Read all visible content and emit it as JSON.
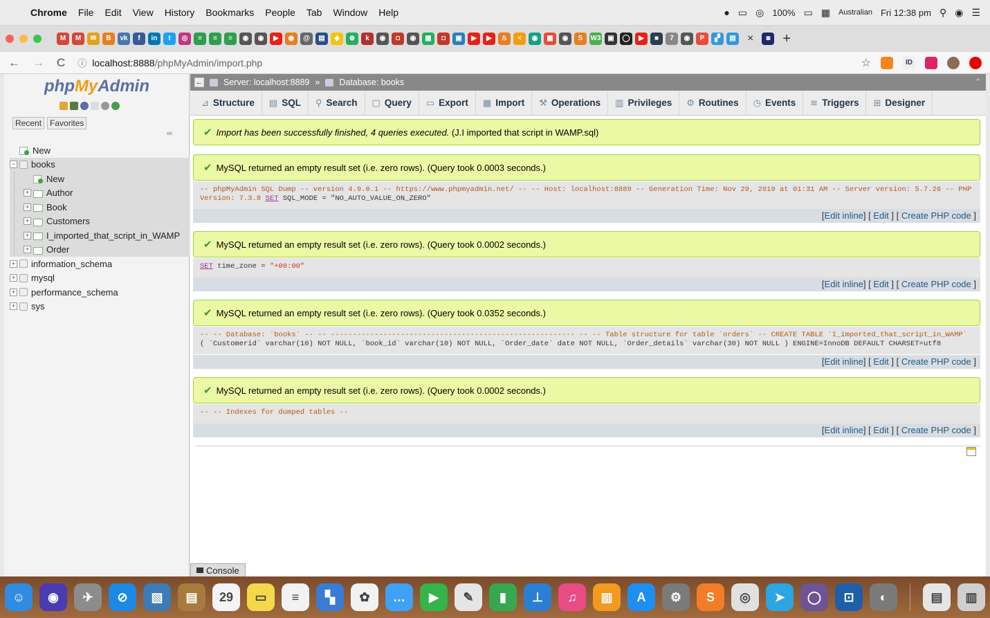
{
  "menubar": {
    "apple": "",
    "items": [
      "Chrome",
      "File",
      "Edit",
      "View",
      "History",
      "Bookmarks",
      "People",
      "Tab",
      "Window",
      "Help"
    ],
    "battery": "100%",
    "locale": "Australian",
    "clock": "Fri 12:38 pm"
  },
  "tabs": {
    "favicons": [
      {
        "label": "M",
        "color": "#d44638"
      },
      {
        "label": "M",
        "color": "#d44638"
      },
      {
        "label": "✉",
        "color": "#e4a11b"
      },
      {
        "label": "B",
        "color": "#e67e22"
      },
      {
        "label": "vk",
        "color": "#4a76a8"
      },
      {
        "label": "f",
        "color": "#3b5998"
      },
      {
        "label": "in",
        "color": "#0077b5"
      },
      {
        "label": "t",
        "color": "#1da1f2"
      },
      {
        "label": "◎",
        "color": "#c13584"
      },
      {
        "label": "≡",
        "color": "#2e9e4f"
      },
      {
        "label": "≡",
        "color": "#2e9e4f"
      },
      {
        "label": "≡",
        "color": "#2e9e4f"
      },
      {
        "label": "◉",
        "color": "#555555"
      },
      {
        "label": "◉",
        "color": "#555555"
      },
      {
        "label": "▶",
        "color": "#e62117"
      },
      {
        "label": "◉",
        "color": "#e67e22"
      },
      {
        "label": "@",
        "color": "#666666"
      },
      {
        "label": "▤",
        "color": "#2b4f81"
      },
      {
        "label": "◆",
        "color": "#f1c40f"
      },
      {
        "label": "⊕",
        "color": "#27ae60"
      },
      {
        "label": "k",
        "color": "#b03030"
      },
      {
        "label": "◉",
        "color": "#555555"
      },
      {
        "label": "◘",
        "color": "#c0392b"
      },
      {
        "label": "◉",
        "color": "#555555"
      },
      {
        "label": "▦",
        "color": "#27ae60"
      },
      {
        "label": "◘",
        "color": "#c0392b"
      },
      {
        "label": "▣",
        "color": "#2980b9"
      },
      {
        "label": "▶",
        "color": "#e62117"
      },
      {
        "label": "▶",
        "color": "#e62117"
      },
      {
        "label": "♨",
        "color": "#e67e22"
      },
      {
        "label": "<",
        "color": "#f39c12"
      },
      {
        "label": "◉",
        "color": "#16a085"
      },
      {
        "label": "▩",
        "color": "#e74c3c"
      },
      {
        "label": "◉",
        "color": "#555555"
      },
      {
        "label": "S",
        "color": "#e67e22"
      },
      {
        "label": "W3",
        "color": "#4caf50"
      },
      {
        "label": "▣",
        "color": "#333333"
      },
      {
        "label": "◯",
        "color": "#222222"
      },
      {
        "label": "▶",
        "color": "#e62117"
      },
      {
        "label": "■",
        "color": "#2c3e50"
      },
      {
        "label": "7",
        "color": "#888888"
      },
      {
        "label": "◉",
        "color": "#555555"
      },
      {
        "label": "P",
        "color": "#e74c3c"
      },
      {
        "label": "▞",
        "color": "#3498db"
      },
      {
        "label": "▤",
        "color": "#3498db"
      }
    ],
    "close": "×",
    "new": "+"
  },
  "address": {
    "host": "localhost:8888",
    "path": "/phpMyAdmin/import.php"
  },
  "logo": {
    "php": "php",
    "my": "My",
    "admin": "Admin"
  },
  "nav": {
    "recent": "Recent",
    "favorites": "Favorites",
    "link_icon": "∞",
    "tree": [
      {
        "label": "New",
        "level": 0,
        "kind": "new"
      },
      {
        "label": "books",
        "level": 0,
        "kind": "db",
        "expanded": true
      },
      {
        "label": "New",
        "level": 1,
        "kind": "new"
      },
      {
        "label": "Author",
        "level": 1,
        "kind": "table"
      },
      {
        "label": "Book",
        "level": 1,
        "kind": "table"
      },
      {
        "label": "Customers",
        "level": 1,
        "kind": "table"
      },
      {
        "label": "I_imported_that_script_in_WAMP",
        "level": 1,
        "kind": "table"
      },
      {
        "label": "Order",
        "level": 1,
        "kind": "table"
      },
      {
        "label": "information_schema",
        "level": 0,
        "kind": "db"
      },
      {
        "label": "mysql",
        "level": 0,
        "kind": "db"
      },
      {
        "label": "performance_schema",
        "level": 0,
        "kind": "db"
      },
      {
        "label": "sys",
        "level": 0,
        "kind": "db"
      }
    ]
  },
  "breadcrumb": {
    "server": "Server: localhost:8889",
    "sep": "»",
    "database": "Database: books"
  },
  "topmenu": [
    {
      "label": "Structure",
      "icon": "structure-icon",
      "glyph": "⊿"
    },
    {
      "label": "SQL",
      "icon": "sql-icon",
      "glyph": "▤"
    },
    {
      "label": "Search",
      "icon": "search-icon",
      "glyph": "⚲"
    },
    {
      "label": "Query",
      "icon": "query-icon",
      "glyph": "▢"
    },
    {
      "label": "Export",
      "icon": "export-icon",
      "glyph": "▭"
    },
    {
      "label": "Import",
      "icon": "import-icon",
      "glyph": "▦"
    },
    {
      "label": "Operations",
      "icon": "wrench-icon",
      "glyph": "⚒"
    },
    {
      "label": "Privileges",
      "icon": "privileges-icon",
      "glyph": "▥"
    },
    {
      "label": "Routines",
      "icon": "routines-icon",
      "glyph": "⚙"
    },
    {
      "label": "Events",
      "icon": "clock-icon",
      "glyph": "◷"
    },
    {
      "label": "Triggers",
      "icon": "triggers-icon",
      "glyph": "≋"
    },
    {
      "label": "Designer",
      "icon": "designer-icon",
      "glyph": "⊞"
    }
  ],
  "import_success": {
    "italic": "Import has been successfully finished, 4 queries executed.",
    "rest": " (J.I imported that script in WAMP.sql)"
  },
  "results": [
    {
      "message": "MySQL returned an empty result set (i.e. zero rows). (Query took 0.0003 seconds.)",
      "sql_line1": "-- phpMyAdmin SQL Dump -- version 4.9.0.1 -- https://www.phpmyadmin.net/ -- -- Host: localhost:8889 -- Generation Time: Nov 29, 2019 at 01:31 AM -- Server version: 5.7.26 -- PHP",
      "sql_line2_a": "Version: 7.3.8 ",
      "sql_line2_kw": "SET",
      "sql_line2_b": " SQL_MODE = \"NO_AUTO_VALUE_ON_ZERO\""
    },
    {
      "message": "MySQL returned an empty result set (i.e. zero rows). (Query took 0.0002 seconds.)",
      "sql_kw": "SET",
      "sql_rest": " time_zone = ",
      "sql_str": "\"+00:00\""
    },
    {
      "message": "MySQL returned an empty result set (i.e. zero rows). (Query took 0.0352 seconds.)",
      "sql_line1": "-- -- Database: `books` -- -- -------------------------------------------------------- -- -- Table structure for table `orders` -- CREATE TABLE `I_imported_that_script_in_WAMP`",
      "sql_line2": "( `Customerid` varchar(10) NOT NULL, `book_id` varchar(10) NOT NULL, `Order_date` date NOT NULL, `Order_details` varchar(30) NOT NULL ) ENGINE=InnoDB DEFAULT CHARSET=utf8"
    },
    {
      "message": "MySQL returned an empty result set (i.e. zero rows). (Query took 0.0002 seconds.)",
      "sql": "-- -- Indexes for dumped tables --"
    }
  ],
  "tools": {
    "edit_inline": "Edit inline",
    "edit": "Edit",
    "create_php": "Create PHP code"
  },
  "console": "Console",
  "dock": [
    {
      "name": "finder",
      "color": "#2f8ce0",
      "glyph": "☺"
    },
    {
      "name": "siri",
      "color": "#4a3bb0",
      "glyph": "◉"
    },
    {
      "name": "launchpad",
      "color": "#8c8c8c",
      "glyph": "✈"
    },
    {
      "name": "safari",
      "color": "#1e88e5",
      "glyph": "⊘"
    },
    {
      "name": "preview",
      "color": "#3c7bb5",
      "glyph": "▧"
    },
    {
      "name": "notes-brown",
      "color": "#a67c3d",
      "glyph": "▤"
    },
    {
      "name": "calendar",
      "color": "#f4f4f4",
      "glyph": "29"
    },
    {
      "name": "stickies",
      "color": "#f5d84a",
      "glyph": "▭"
    },
    {
      "name": "notes",
      "color": "#f2f2f2",
      "glyph": "≡"
    },
    {
      "name": "photobooth",
      "color": "#3a7bd5",
      "glyph": "▚"
    },
    {
      "name": "photos",
      "color": "#f2f2f2",
      "glyph": "✿"
    },
    {
      "name": "messages",
      "color": "#3da1f5",
      "glyph": "…"
    },
    {
      "name": "facetime",
      "color": "#36b34a",
      "glyph": "▶"
    },
    {
      "name": "textedit",
      "color": "#e5e5e5",
      "glyph": "✎"
    },
    {
      "name": "numbers",
      "color": "#36a852",
      "glyph": "▮"
    },
    {
      "name": "keynote",
      "color": "#2a7fd4",
      "glyph": "⊥"
    },
    {
      "name": "itunes",
      "color": "#e94b84",
      "glyph": "♫"
    },
    {
      "name": "books",
      "color": "#f39a1e",
      "glyph": "▥"
    },
    {
      "name": "appstore",
      "color": "#1f8ef1",
      "glyph": "A"
    },
    {
      "name": "sysprefs",
      "color": "#7a7a7a",
      "glyph": "⚙"
    },
    {
      "name": "sublime",
      "color": "#f27d26",
      "glyph": "S"
    },
    {
      "name": "chrome",
      "color": "#e0e0e0",
      "glyph": "◎"
    },
    {
      "name": "telegram",
      "color": "#2ca5e0",
      "glyph": "➤"
    },
    {
      "name": "github",
      "color": "#6e5494",
      "glyph": "◯"
    },
    {
      "name": "sourcetree",
      "color": "#1d5fa8",
      "glyph": "⊡"
    },
    {
      "name": "sequelpro",
      "color": "#7a7a7a",
      "glyph": "◐"
    },
    {
      "name": "documents",
      "color": "#e5e5e5",
      "glyph": "▤"
    },
    {
      "name": "trash",
      "color": "#cfcfcf",
      "glyph": "▥"
    }
  ]
}
